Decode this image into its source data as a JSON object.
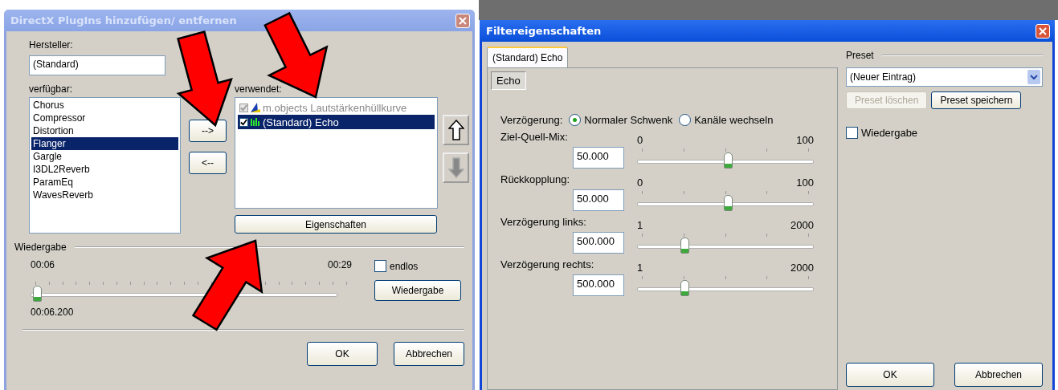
{
  "left_dialog": {
    "title": "DirectX PlugIns hinzufügen/ entfernen",
    "active": false,
    "manufacturer": {
      "label": "Hersteller:",
      "value": "(Standard)"
    },
    "available": {
      "label": "verfügbar:",
      "items": [
        {
          "label": "Chorus",
          "selected": false
        },
        {
          "label": "Compressor",
          "selected": false
        },
        {
          "label": "Distortion",
          "selected": false
        },
        {
          "label": "Flanger",
          "selected": true
        },
        {
          "label": "Gargle",
          "selected": false
        },
        {
          "label": "I3DL2Reverb",
          "selected": false
        },
        {
          "label": "ParamEq",
          "selected": false
        },
        {
          "label": "WavesReverb",
          "selected": false
        }
      ]
    },
    "add_button": "-->",
    "remove_button": "<--",
    "used": {
      "label": "verwendet:",
      "items": [
        {
          "label": "m.objects Lautstärkenhüllkurve",
          "kind": "envelope",
          "checked": true,
          "disabled": true,
          "selected": false
        },
        {
          "label": "(Standard) Echo",
          "kind": "echo",
          "checked": true,
          "disabled": false,
          "selected": true
        }
      ]
    },
    "move_up": {
      "disabled": false
    },
    "move_down": {
      "disabled": true
    },
    "properties_button": "Eigenschaften",
    "playback": {
      "title": "Wiedergabe",
      "start": "00:06",
      "end": "00:29",
      "position": "00:06.200",
      "level": 0.01,
      "loop": {
        "label": "endlos",
        "checked": false
      },
      "play_button": "Wiedergabe"
    },
    "buttons": [
      "OK",
      "Abbrechen"
    ]
  },
  "right_dialog": {
    "title": "Filtereigenschaften",
    "active": true,
    "tabs": [
      {
        "label": "(Standard) Echo",
        "selected": true
      }
    ],
    "subtab": "Echo",
    "delay_mode": {
      "label": "Verzögerung:",
      "options": [
        {
          "label": "Normaler Schwenk",
          "selected": true
        },
        {
          "label": "Kanäle wechseln",
          "selected": false
        }
      ]
    },
    "sliders": [
      {
        "label": "Ziel-Quell-Mix:",
        "value": "50.000",
        "min": "0",
        "max": "100",
        "level": 0.5
      },
      {
        "label": "Rückkopplung:",
        "value": "50.000",
        "min": "0",
        "max": "100",
        "level": 0.5
      },
      {
        "label": "Verzögerung links:",
        "value": "500.000",
        "min": "1",
        "max": "2000",
        "level": 0.25
      },
      {
        "label": "Verzögerung rechts:",
        "value": "500.000",
        "min": "1",
        "max": "2000",
        "level": 0.25
      }
    ],
    "preset": {
      "title": "Preset",
      "value": "(Neuer Eintrag)",
      "buttons": [
        {
          "label": "Preset löschen",
          "disabled": true
        },
        {
          "label": "Preset speichern",
          "disabled": false
        }
      ],
      "playback": {
        "label": "Wiedergabe",
        "checked": false
      }
    },
    "buttons": [
      "OK",
      "Abbrechen"
    ]
  }
}
